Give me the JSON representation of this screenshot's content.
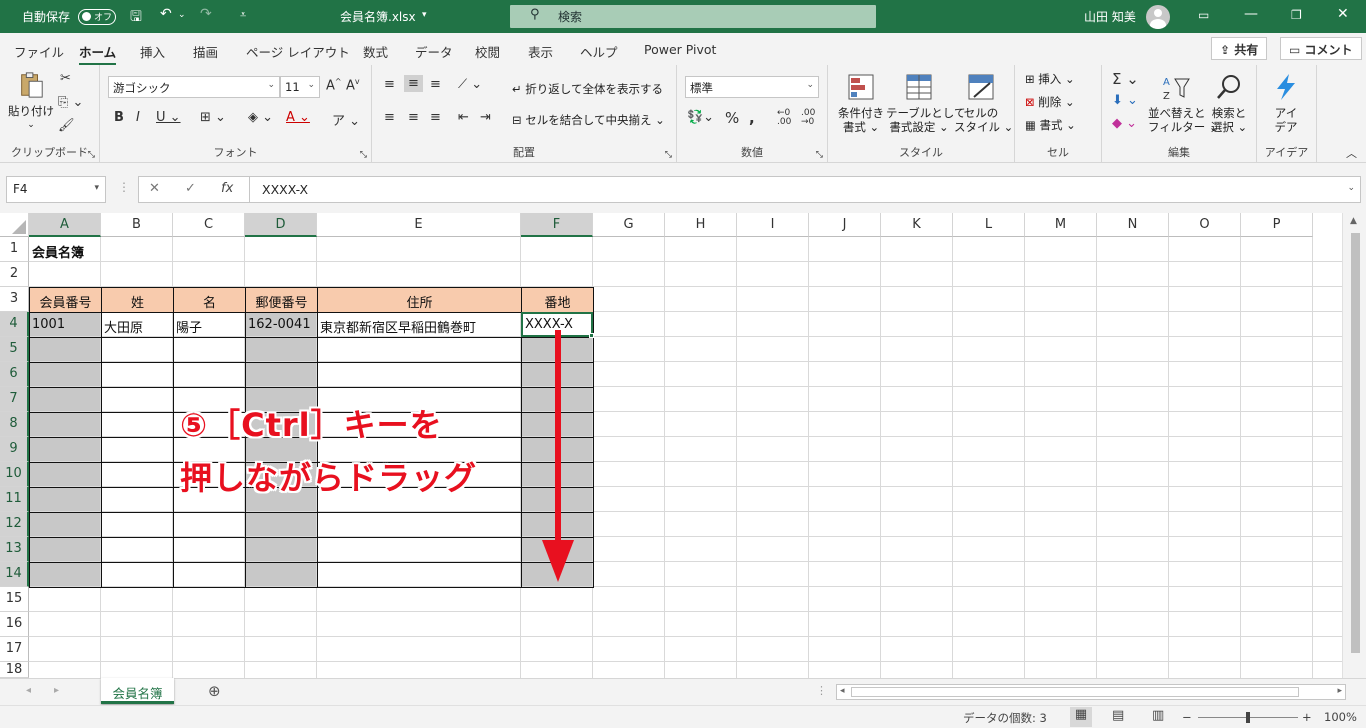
{
  "titlebar": {
    "autosave_label": "自動保存",
    "autosave_state": "オフ",
    "filename": "会員名簿.xlsx",
    "search_placeholder": "検索",
    "user_name": "山田 知美"
  },
  "ribbon_tabs": [
    "ファイル",
    "ホーム",
    "挿入",
    "描画",
    "ページ レイアウト",
    "数式",
    "データ",
    "校閲",
    "表示",
    "ヘルプ",
    "Power Pivot"
  ],
  "share_label": "共有",
  "comment_label": "コメント",
  "ribbon": {
    "clipboard": {
      "paste": "貼り付け",
      "label": "クリップボード"
    },
    "font": {
      "name": "游ゴシック",
      "size": "11",
      "label": "フォント"
    },
    "alignment": {
      "wrap": "折り返して全体を表示する",
      "merge": "セルを結合して中央揃え",
      "label": "配置"
    },
    "number": {
      "format": "標準",
      "label": "数値"
    },
    "styles": {
      "cond1": "条件付き",
      "cond2": "書式",
      "table1": "テーブルとして",
      "table2": "書式設定",
      "cell1": "セルの",
      "cell2": "スタイル",
      "label": "スタイル"
    },
    "cells": {
      "insert": "挿入",
      "delete": "削除",
      "format": "書式",
      "label": "セル"
    },
    "editing": {
      "sort1": "並べ替えと",
      "sort2": "フィルター",
      "find1": "検索と",
      "find2": "選択",
      "label": "編集"
    },
    "ideas": {
      "l1": "アイ",
      "l2": "デア",
      "label": "アイデア"
    }
  },
  "formula_bar": {
    "name_box": "F4",
    "formula": "XXXX-X"
  },
  "columns": [
    "A",
    "B",
    "C",
    "D",
    "E",
    "F",
    "G",
    "H",
    "I",
    "J",
    "K",
    "L",
    "M",
    "N",
    "O",
    "P"
  ],
  "rows": [
    "1",
    "2",
    "3",
    "4",
    "5",
    "6",
    "7",
    "8",
    "9",
    "10",
    "11",
    "12",
    "13",
    "14",
    "15",
    "16",
    "17",
    "18"
  ],
  "sheet": {
    "title": "会員名簿",
    "headers": [
      "会員番号",
      "姓",
      "名",
      "郵便番号",
      "住所",
      "番地"
    ],
    "row4": [
      "1001",
      "大田原",
      "陽子",
      "162-0041",
      "東京都新宿区早稲田鶴巻町",
      "XXXX-X"
    ]
  },
  "annotation": {
    "line1": "⑤［Ctrl］キーを",
    "line2": "押しながらドラッグ"
  },
  "sheet_tab": "会員名簿",
  "status": {
    "count": "データの個数: 3",
    "zoom": "100%"
  },
  "colors": {
    "excel_green": "#217346",
    "header_fill": "#f8cbad",
    "selection_gray": "#c8c8c8",
    "annotation_red": "#e8101f"
  }
}
